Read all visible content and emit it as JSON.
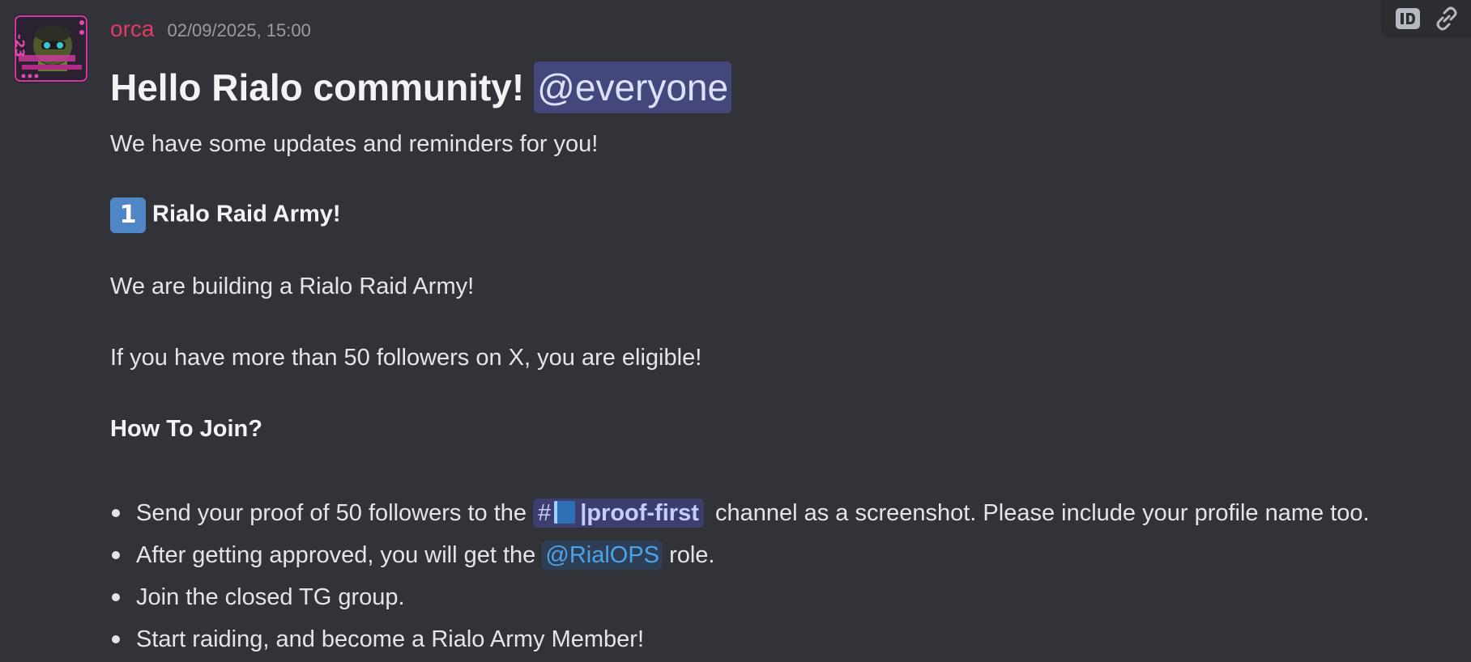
{
  "message": {
    "username": "orca",
    "timestamp": "02/09/2025, 15:00",
    "heading_text": "Hello Rialo community!",
    "heading_mention": "@everyone",
    "intro": "We have some updates and reminders for you!",
    "section_number": "1",
    "section_title": "Rialo Raid Army!",
    "para1": "We are building a Rialo Raid Army!",
    "para2": "If you have more than 50 followers on X, you are eligible!",
    "how_to_join": "How To Join?",
    "bullets": [
      {
        "before": "Send your proof of 50 followers to the",
        "channel_hash": "#",
        "channel_name": "|proof-first",
        "after": "channel as a screenshot. Please include your profile name too."
      },
      {
        "before": "After getting approved, you will get the",
        "role": "@RialOPS",
        "after": "role."
      },
      {
        "text": "Join the closed TG group."
      },
      {
        "text": "Start raiding, and become a Rialo Army Member!"
      }
    ]
  },
  "avatar": {
    "badge_text": "-23"
  },
  "toolbar": {
    "icons": [
      "id-icon",
      "link-icon"
    ]
  },
  "colors": {
    "background": "#323339",
    "username": "#e03a65",
    "mention_bg": "#44477a",
    "role_color": "#4ba3e8",
    "keycap_bg": "#4e86c6"
  }
}
